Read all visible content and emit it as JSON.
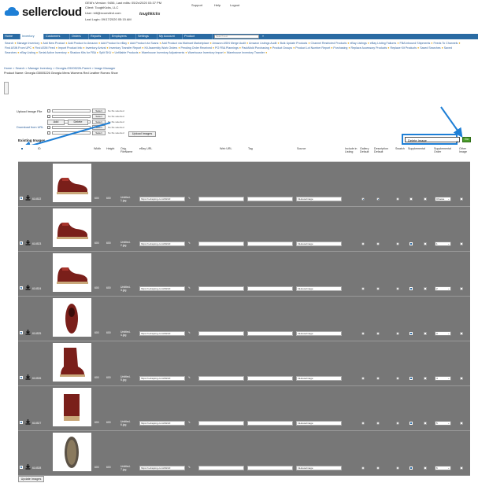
{
  "header": {
    "brand": "sellercloud",
    "account_lines": [
      "OEM's Version: 9456, Last edits: 05/2x/2020 03:37 PM",
      "Client: ToughKicks, LLC",
      "User: bill@ecomdirct.com",
      "Last Login: 09/17/2020 05:15 AM"
    ],
    "client_logo": "toughkicks",
    "links": [
      "Support",
      "Help",
      "Logout"
    ]
  },
  "nav": {
    "items": [
      "Home",
      "Inventory",
      "Customers",
      "Orders",
      "Reports",
      "Employees",
      "Settings",
      "My Account",
      "Product"
    ],
    "active": "Inventory",
    "search_placeholder": "Search text",
    "go_label": "»"
  },
  "submenu": [
    "Search",
    "Manage Inventory",
    "Add New Product",
    "Add Product to Amazon",
    "Add Product to eBay",
    "Add Product via Scans",
    "Add Product via Walmart Marketplace",
    "Amazon ASIN Merge Audit",
    "Amazon Listings Audit",
    "Bulk Update Products",
    "Channel Restricted Products",
    "eBay Listings",
    "eBay Listing Failures",
    "FBA Inbound Shipments",
    "Feeds To Channels",
    "Find ASIN From UPC",
    "Find ASIN Feed",
    "Import Product Info",
    "Inventory Arrival",
    "Inventory Transfer Report",
    "Kit Assembly Work Orders",
    "Pending Order Received",
    "PO FBA Plannings",
    "PackMold Purchasing",
    "Product Groups",
    "Product Lot Number Report",
    "Purchasing",
    "Replace Accessory Products",
    "Replace Kit Products",
    "Saved Searches",
    "Saved Searches",
    "eBay Listing",
    "Serial Active Inventory",
    "Shadow Kits for FBA",
    "Split SKU",
    "Unfillable Products",
    "Warehouse Inventory Adjustments",
    "Warehouse Inventory Import",
    "Warehouse Inventory Transfer"
  ],
  "breadcrumb": "Home > Search > Manage Inventory > Georgia-G5005226-Parent > Image Manager",
  "product_name": "Product Name: Georgia G5005226 Georgia Mens Womens Red Leather Romeo Shoe",
  "upload": {
    "label": "Upload Image File",
    "select_label": "Select",
    "file_status": "No file selected",
    "rows": 5,
    "add_label": "Add",
    "delete_label": "Delete",
    "download_label": "Download from URL",
    "upload_images_label": "Upload Images"
  },
  "section_title": "Existing Images",
  "bulk_action": {
    "value": "Delete Image",
    "go_label": "Go"
  },
  "columns": [
    "Width",
    "Height",
    "Orig. FileName",
    "eBay URL",
    "Web URL",
    "Tag",
    "Source",
    "Include in Listing",
    "Gallery Default",
    "Description Default",
    "Swatch",
    "Supplemental",
    "Supplemental Order",
    "Other Image"
  ],
  "rows": [
    {
      "id": "614522",
      "width": "600",
      "height": "600",
      "file": "Untitled-1.jpg",
      "ebay": "https://i.ebayimg.com/00/s/0",
      "web": "",
      "tag": "",
      "source": "InHouseImage",
      "gallery": true,
      "desc": true,
      "swatch": false,
      "supp": false,
      "order": "Choose"
    },
    {
      "id": "614523",
      "width": "600",
      "height": "600",
      "file": "Untitled-2.jpg",
      "ebay": "https://i.ebayimg.com/00/s/0",
      "web": "",
      "tag": "",
      "source": "InHouseImage",
      "gallery": false,
      "desc": false,
      "swatch": false,
      "supp": true,
      "order": "1"
    },
    {
      "id": "614524",
      "width": "600",
      "height": "600",
      "file": "Untitled-3.jpg",
      "ebay": "https://i.ebayimg.com/00/s/0",
      "web": "",
      "tag": "",
      "source": "InHouseImage",
      "gallery": false,
      "desc": false,
      "swatch": false,
      "supp": true,
      "order": "2"
    },
    {
      "id": "614525",
      "width": "600",
      "height": "600",
      "file": "Untitled-4.jpg",
      "ebay": "https://i.ebayimg.com/00/s/0",
      "web": "",
      "tag": "",
      "source": "InHouseImage",
      "gallery": false,
      "desc": false,
      "swatch": false,
      "supp": true,
      "order": "3"
    },
    {
      "id": "614526",
      "width": "600",
      "height": "600",
      "file": "Untitled-5.jpg",
      "ebay": "https://i.ebayimg.com/00/s/0",
      "web": "",
      "tag": "",
      "source": "InHouseImage",
      "gallery": false,
      "desc": false,
      "swatch": false,
      "supp": true,
      "order": "4"
    },
    {
      "id": "614527",
      "width": "600",
      "height": "600",
      "file": "Untitled-6.jpg",
      "ebay": "https://i.ebayimg.com/00/s/0",
      "web": "",
      "tag": "",
      "source": "InHouseImage",
      "gallery": false,
      "desc": false,
      "swatch": false,
      "supp": true,
      "order": "5"
    },
    {
      "id": "614528",
      "width": "600",
      "height": "600",
      "file": "Untitled-7.jpg",
      "ebay": "https://i.ebayimg.com/00/s/0",
      "web": "",
      "tag": "",
      "source": "InHouseImage",
      "gallery": false,
      "desc": false,
      "swatch": false,
      "supp": true,
      "order": "6"
    }
  ],
  "update_label": "Update Images",
  "colors": {
    "nav": "#2a6ba3",
    "row_bg": "#777777",
    "go": "#4a9b2a",
    "arrow": "#1e7fd6"
  }
}
